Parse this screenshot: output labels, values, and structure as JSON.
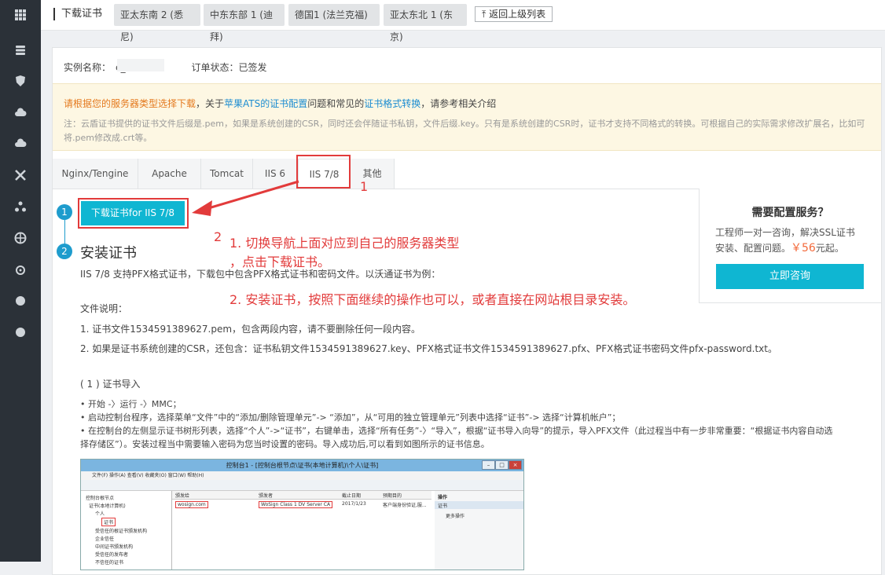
{
  "sidebar": {
    "icons": [
      "grid-icon",
      "database-icon",
      "shield-icon",
      "cloud-icon",
      "cloud-upload-icon",
      "network-icon",
      "cluster-icon",
      "globe-icon",
      "settings-icon",
      "dot-icon",
      "dot-icon"
    ]
  },
  "topbar": {
    "title": "下载证书",
    "regions": [
      "亚太东南 2 (悉尼)",
      "中东东部 1 (迪拜)",
      "德国1 (法兰克福)",
      "亚太东北 1 (东京)"
    ],
    "back": "返回上级列表",
    "back_icon": "⤒"
  },
  "info": {
    "instance_label": "实例名称：",
    "instance_value": "c_",
    "status_label": "订单状态：",
    "status_value": "已签发"
  },
  "notice": {
    "p1": "请根据您的服务器类型选择下载",
    "p2": "，关于",
    "link1": "苹果ATS的证书配置",
    "p3": "问题和常见的",
    "link2": "证书格式转换",
    "p4": "，请参考相关介绍",
    "note": "注：云盾证书提供的证书文件后缀是.pem，如果是系统创建的CSR，同时还会伴随证书私钥，文件后缀.key。只有是系统创建的CSR时，证书才支持不同格式的转换。可根据自己的实际需求修改扩展名，比如可将.pem修改成.crt等。"
  },
  "tabs": [
    "Nginx/Tengine",
    "Apache",
    "Tomcat",
    "IIS 6",
    "IIS 7/8",
    "其他"
  ],
  "active_tab": "IIS 7/8",
  "download_button": "下载证书for IIS 7/8",
  "steps": {
    "s1": "1",
    "s2": "2",
    "install_title": "安装证书"
  },
  "annotations": {
    "n1": "1",
    "n2": "2",
    "line1": "1. 切换导航上面对应到自己的服务器类型",
    "line1b": "，点击下载证书。",
    "line2": "2. 安装证书，按照下面继续的操作也可以，或者直接在网站根目录安装。"
  },
  "content": {
    "intro": "IIS 7/8 支持PFX格式证书，下载包中包含PFX格式证书和密码文件。以沃通证书为例：",
    "file_desc": "文件说明：",
    "item1": "1. 证书文件1534591389627.pem，包含两段内容，请不要删除任何一段内容。",
    "item2": "2. 如果是证书系统创建的CSR，还包含：证书私钥文件1534591389627.key、PFX格式证书文件1534591389627.pfx、PFX格式证书密码文件pfx-password.txt。",
    "import_title": "( 1 ) 证书导入",
    "b1": "• 开始 -〉运行 -〉MMC；",
    "b2": "• 启动控制台程序，选择菜单“文件”中的“添加/删除管理单元”-> “添加”，从“可用的独立管理单元”列表中选择“证书”-> 选择“计算机帐户”；",
    "b3": "• 在控制台的左侧显示证书树形列表，选择“个人”->“证书”，右键单击，选择“所有任务”-〉“导入”，根据“证书导入向导”的提示，导入PFX文件（此过程当中有一步非常重要：“根据证书内容自动选",
    "b4": "择存储区”）。安装过程当中需要输入密码为您当时设置的密码。导入成功后,可以看到如图所示的证书信息。"
  },
  "right_panel": {
    "title": "需要配置服务？",
    "desc1": "工程师一对一咨询，解决SSL证书",
    "desc2": "安装、配置问题。",
    "price": "￥56",
    "price_suffix": "元起。",
    "button": "立即咨询"
  },
  "screenshot": {
    "title": "控制台1 - [控制台根节点\\证书(本地计算机)\\个人\\证书]",
    "menu": "文件(F)   操作(A)   查看(V)   收藏夹(O)   窗口(W)   帮助(H)",
    "tree": [
      "控制台根节点",
      "证书(本地计算机)",
      "个人",
      "证书",
      "受信任的根证书颁发机构",
      "企业信任",
      "中间证书颁发机构",
      "受信任的发布者",
      "不信任的证书"
    ],
    "cols": [
      "颁发给",
      "颁发者",
      "截止日期",
      "预期目的"
    ],
    "row": [
      "wosign.com",
      "WoSign Class 1 DV Server CA",
      "2017/1/23",
      "客户端身份验证,服..."
    ],
    "action_title": "操作",
    "action_sub": "证书",
    "action_more": "更多操作"
  }
}
